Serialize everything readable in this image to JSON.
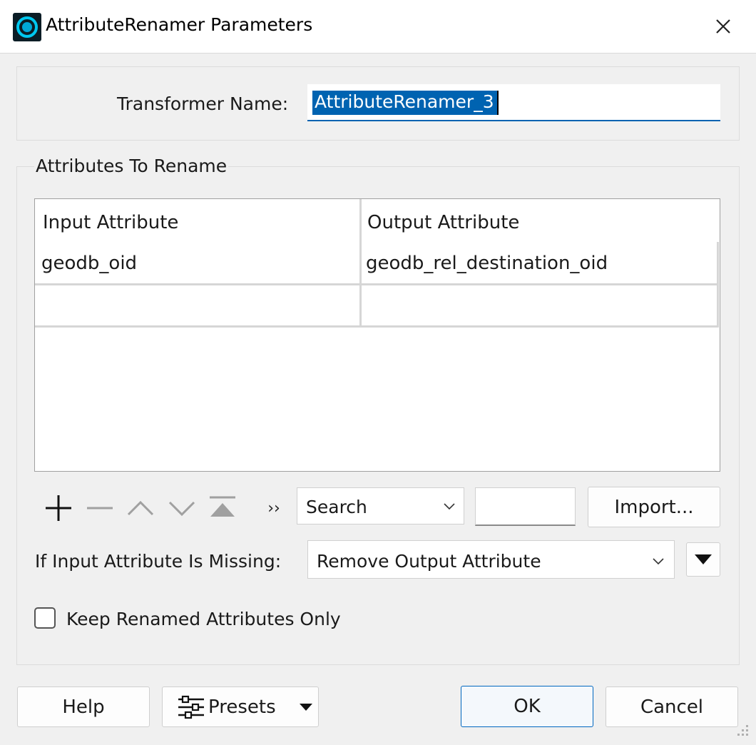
{
  "window": {
    "title": "AttributeRenamer Parameters",
    "close_icon": "close-icon",
    "app_icon": "fme-transformer-icon"
  },
  "transformer": {
    "label": "Transformer Name:",
    "value": "AttributeRenamer_3"
  },
  "attributes_group": {
    "title": "Attributes To Rename",
    "columns": [
      "Input Attribute",
      "Output Attribute"
    ],
    "rows": [
      [
        "geodb_oid",
        "geodb_rel_destination_oid"
      ],
      [
        "",
        ""
      ]
    ]
  },
  "toolbar": {
    "icons": [
      "add-icon",
      "remove-icon",
      "move-up-icon",
      "move-down-icon",
      "move-to-top-icon",
      "more-icon"
    ],
    "more_glyph": "››",
    "search_mode": "Search",
    "search_text": "",
    "import_label": "Import..."
  },
  "missing": {
    "label": "If Input Attribute Is Missing:",
    "value": "Remove Output Attribute"
  },
  "keep_only": {
    "label": "Keep Renamed Attributes Only",
    "checked": false
  },
  "footer": {
    "help_label": "Help",
    "presets_label": "Presets",
    "ok_label": "OK",
    "cancel_label": "Cancel"
  },
  "colors": {
    "selection": "#0063b1",
    "background": "#f0f0f0",
    "icon_accent": "#00b4e6"
  }
}
